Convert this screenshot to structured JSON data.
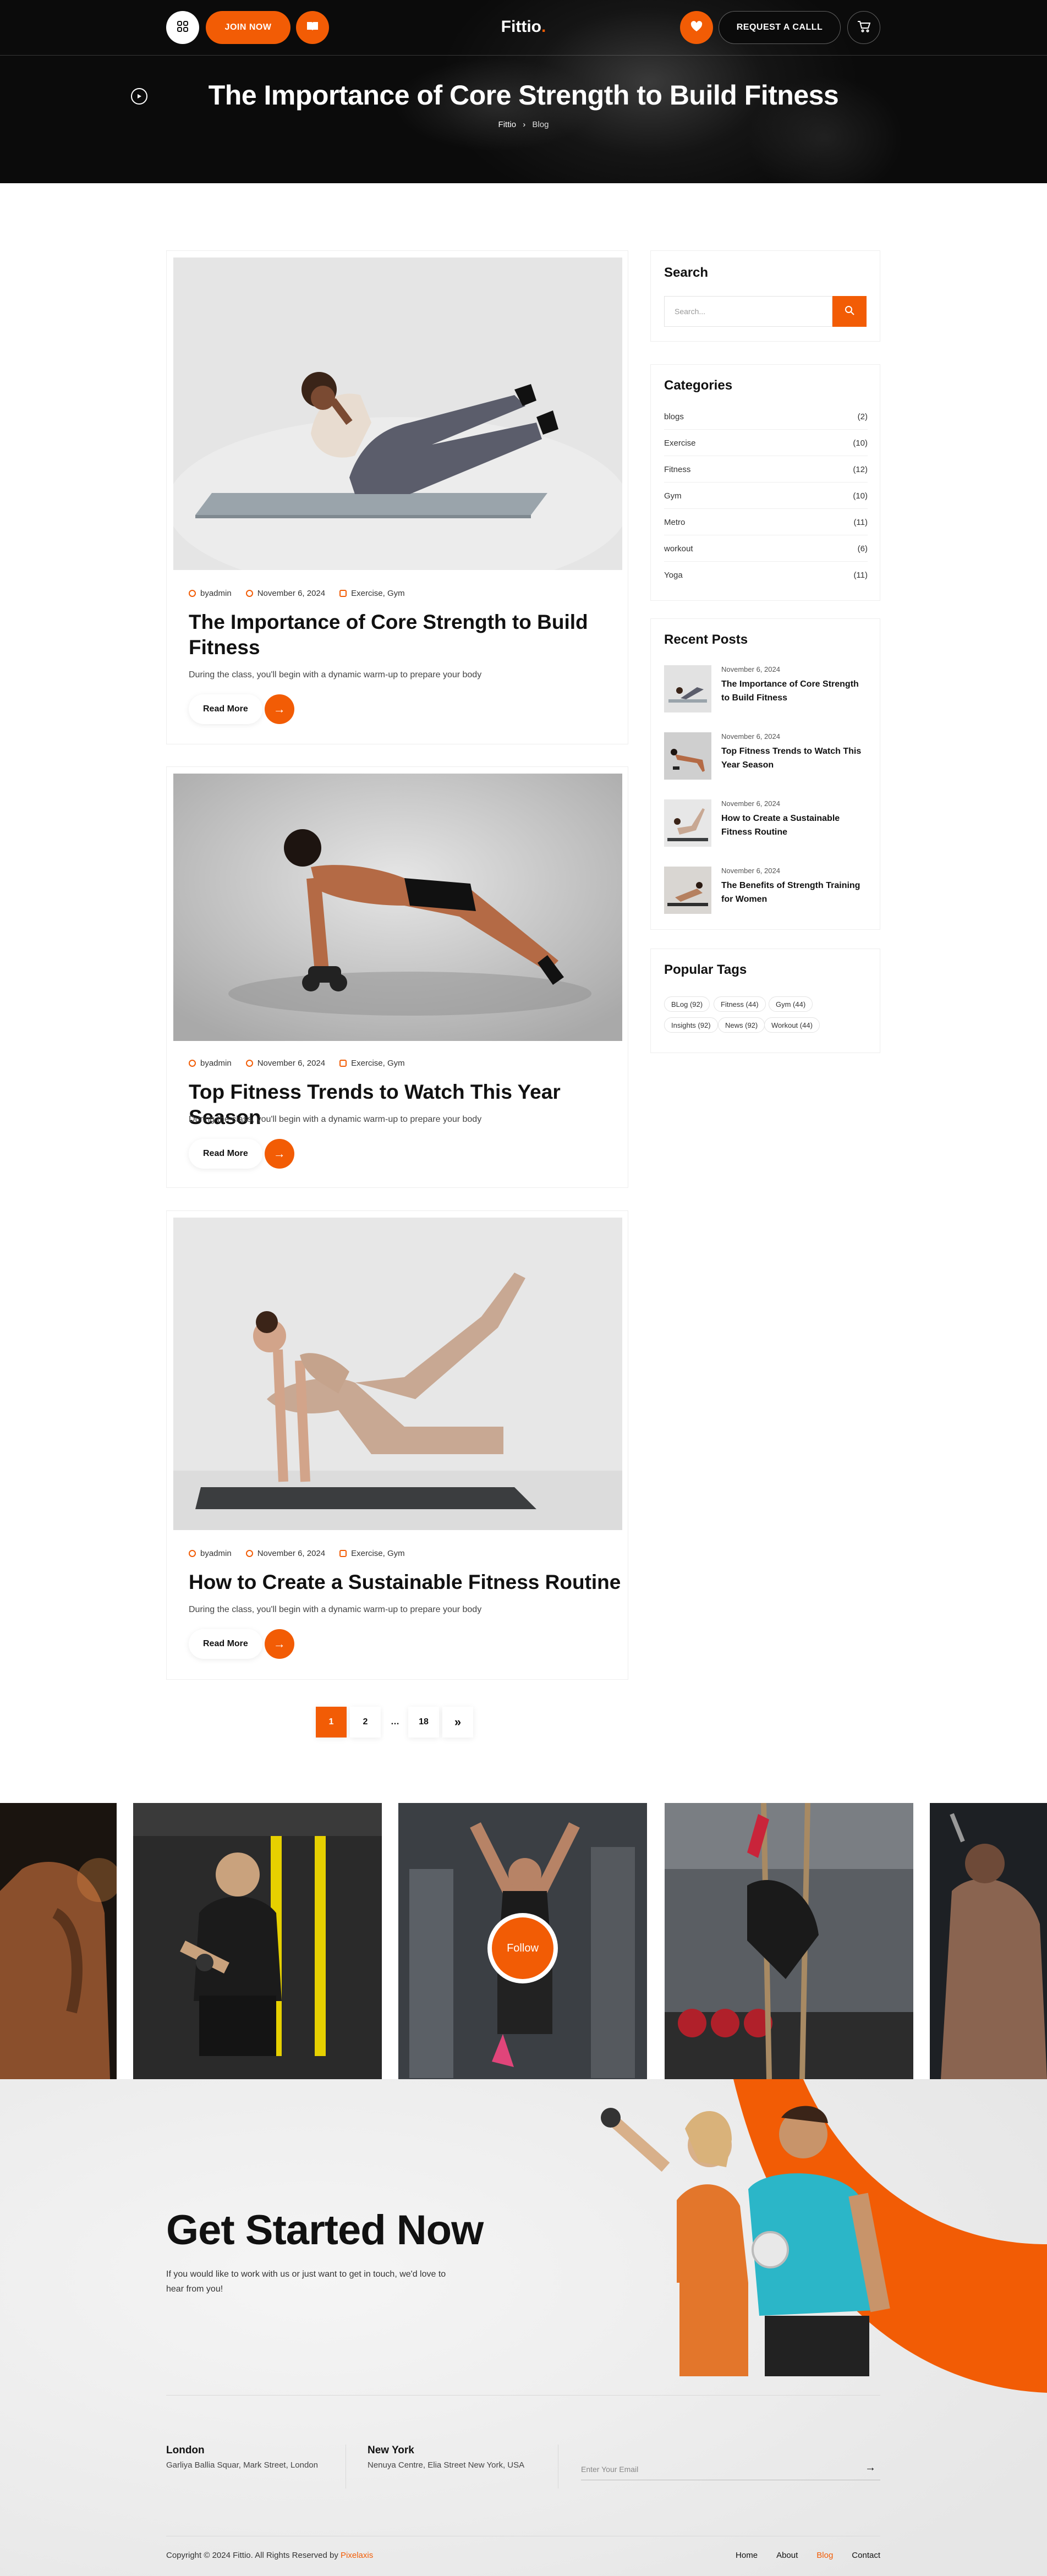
{
  "header": {
    "logo_main": "Fittio",
    "logo_dot": ".",
    "join_label": "JOIN NOW",
    "request_label": "REQUEST A CALLL",
    "hero_title": "The Importance of Core Strength to Build Fitness",
    "breadcrumb_home": "Fittio",
    "breadcrumb_sep": "›",
    "breadcrumb_current": "Blog"
  },
  "posts": [
    {
      "author": "byadmin",
      "date": "November 6, 2024",
      "categories": "Exercise, Gym",
      "title": "The Importance of Core Strength to Build Fitness",
      "excerpt": "During the class, you'll begin with a dynamic warm-up to prepare your body",
      "read_more": "Read More"
    },
    {
      "author": "byadmin",
      "date": "November 6, 2024",
      "categories": "Exercise, Gym",
      "title": "Top Fitness Trends to Watch This Year Season",
      "excerpt": "During the class, you'll begin with a dynamic warm-up to prepare your body",
      "read_more": "Read More"
    },
    {
      "author": "byadmin",
      "date": "November 6, 2024",
      "categories": "Exercise, Gym",
      "title": "How to Create a Sustainable Fitness Routine",
      "excerpt": "During the class, you'll begin with a dynamic warm-up to prepare your body",
      "read_more": "Read More"
    }
  ],
  "pagination": {
    "p1": "1",
    "p2": "2",
    "dots": "…",
    "last": "18",
    "next": "»"
  },
  "sidebar": {
    "search_title": "Search",
    "search_placeholder": "Search...",
    "categories_title": "Categories",
    "categories": [
      {
        "name": "blogs",
        "count": "(2)"
      },
      {
        "name": "Exercise",
        "count": "(10)"
      },
      {
        "name": "Fitness",
        "count": "(12)"
      },
      {
        "name": "Gym",
        "count": "(10)"
      },
      {
        "name": "Metro",
        "count": "(11)"
      },
      {
        "name": "workout",
        "count": "(6)"
      },
      {
        "name": "Yoga",
        "count": "(11)"
      }
    ],
    "recent_title": "Recent Posts",
    "recent": [
      {
        "date": "November 6, 2024",
        "title": "The Importance of Core Strength to Build Fitness"
      },
      {
        "date": "November 6, 2024",
        "title": "Top Fitness Trends to Watch This Year Season"
      },
      {
        "date": "November 6, 2024",
        "title": "How to Create a Sustainable Fitness Routine"
      },
      {
        "date": "November 6, 2024",
        "title": "The Benefits of Strength Training for Women"
      }
    ],
    "tags_title": "Popular Tags",
    "tags": [
      "BLog (92)",
      "Fitness (44)",
      "Gym (44)",
      "Insights (92)",
      "News (92)",
      "Workout (44)"
    ]
  },
  "gallery": {
    "follow_label": "Follow"
  },
  "cta": {
    "title": "Get Started Now",
    "text": "If you would like to work with us or just want to get in touch, we'd love to hear from you!"
  },
  "footer": {
    "office1_city": "London",
    "office1_addr": "Garliya Ballia Squar, Mark Street, London",
    "office2_city": "New York",
    "office2_addr": "Nenuya Centre, Elia Street New York, USA",
    "email_placeholder": "Enter Your Email",
    "copyright": "Copyright © 2024 Fittio. All Rights Reserved by ",
    "copyright_brand": "Pixelaxis",
    "nav": [
      "Home",
      "About",
      "Blog",
      "Contact"
    ],
    "active_nav": "Blog"
  },
  "colors": {
    "accent": "#f25c05",
    "dark": "#0b0b0b",
    "light_bg": "#efefef"
  }
}
